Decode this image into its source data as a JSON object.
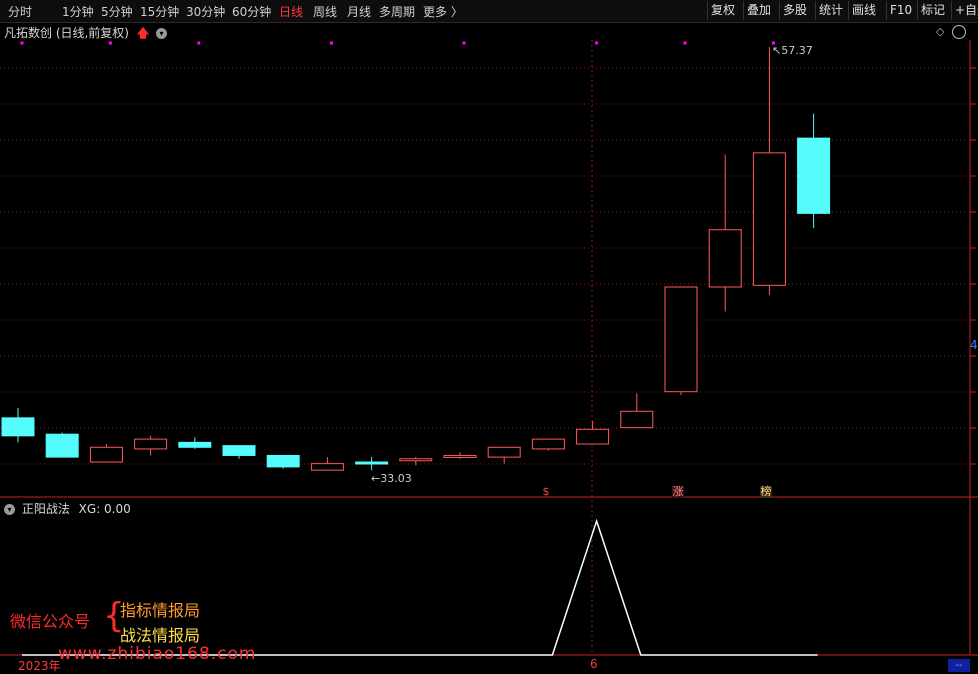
{
  "toolbar": {
    "periods": [
      "分时",
      "1分钟",
      "5分钟",
      "15分钟",
      "30分钟",
      "60分钟",
      "日线",
      "周线",
      "月线",
      "多周期",
      "更多 〉"
    ],
    "active_period": "日线",
    "buttons": [
      "复权",
      "叠加",
      "多股",
      "统计",
      "画线",
      "F10",
      "标记",
      "+自选"
    ]
  },
  "chart_header": {
    "title": "凡拓数创 (日线,前复权)",
    "icons": [
      "arrow-up-icon",
      "chevron-down-icon",
      "diamond-icon"
    ]
  },
  "markers": {
    "high_label": "57.37",
    "low_label": "33.03",
    "right_axis_fragment": "4",
    "event_tags": [
      "$",
      "涨",
      "榜"
    ]
  },
  "indicator": {
    "title": "正阳战法",
    "value_label": "XG: 0.00"
  },
  "x_axis": {
    "year_label": "2023年",
    "month_label": "6",
    "corner_label": "--"
  },
  "watermark": {
    "prefix": "微信公众号",
    "line1": "指标情报局",
    "line2": "战法情报局",
    "url": "www.zhibiao168.com"
  },
  "colors": {
    "up": "#ff5a5a",
    "down": "#54fcfc",
    "grid": "#a01010",
    "signal_dot": "#ff00ff",
    "indicator_line": "#ffffff",
    "active_period": "#ff3a3a"
  },
  "chart_data": {
    "type": "candlestick",
    "title": "凡拓数创 (日线,前复权)",
    "price_scale": "unlabeled",
    "candles": [
      {
        "open": 34.7,
        "close": 33.6,
        "high": 35.3,
        "low": 33.2,
        "dir": "down"
      },
      {
        "open": 33.7,
        "close": 32.3,
        "high": 33.8,
        "low": 32.3,
        "dir": "down"
      },
      {
        "open": 32.0,
        "close": 32.9,
        "high": 33.1,
        "low": 32.0,
        "dir": "up"
      },
      {
        "open": 32.8,
        "close": 33.4,
        "high": 33.6,
        "low": 32.4,
        "dir": "up"
      },
      {
        "open": 33.2,
        "close": 32.9,
        "high": 33.5,
        "low": 32.8,
        "dir": "down"
      },
      {
        "open": 33.0,
        "close": 32.4,
        "high": 33.0,
        "low": 32.2,
        "dir": "down"
      },
      {
        "open": 32.4,
        "close": 31.7,
        "high": 32.4,
        "low": 31.6,
        "dir": "down"
      },
      {
        "open": 31.5,
        "close": 31.9,
        "high": 32.3,
        "low": 31.5,
        "dir": "up"
      },
      {
        "open": 32.0,
        "close": 31.9,
        "high": 32.3,
        "low": 31.5,
        "dir": "down"
      },
      {
        "open": 32.1,
        "close": 32.2,
        "high": 32.3,
        "low": 31.8,
        "dir": "up"
      },
      {
        "open": 32.4,
        "close": 32.4,
        "high": 32.6,
        "low": 32.2,
        "dir": "up"
      },
      {
        "open": 32.3,
        "close": 32.9,
        "high": 32.9,
        "low": 31.9,
        "dir": "up"
      },
      {
        "open": 32.8,
        "close": 33.4,
        "high": 33.4,
        "low": 32.7,
        "dir": "up"
      },
      {
        "open": 33.1,
        "close": 34.0,
        "high": 34.5,
        "low": 33.1,
        "dir": "up"
      },
      {
        "open": 34.1,
        "close": 35.1,
        "high": 36.2,
        "low": 34.1,
        "dir": "up"
      },
      {
        "open": 36.3,
        "close": 42.7,
        "high": 42.7,
        "low": 36.1,
        "dir": "up"
      },
      {
        "open": 42.7,
        "close": 46.2,
        "high": 50.8,
        "low": 41.2,
        "dir": "up"
      },
      {
        "open": 42.8,
        "close": 50.9,
        "high": 57.37,
        "low": 42.2,
        "dir": "up"
      },
      {
        "open": 51.8,
        "close": 47.2,
        "high": 53.3,
        "low": 46.3,
        "dir": "down"
      }
    ],
    "signal_dot_indices": [
      0,
      2,
      4,
      7,
      10,
      13,
      15,
      17
    ],
    "xg_series": [
      0,
      0,
      0,
      0,
      0,
      0,
      0,
      0,
      0,
      0,
      0,
      0,
      0,
      1,
      0,
      0,
      0,
      0,
      0
    ],
    "xg_range": [
      0,
      1
    ],
    "grid": true
  }
}
